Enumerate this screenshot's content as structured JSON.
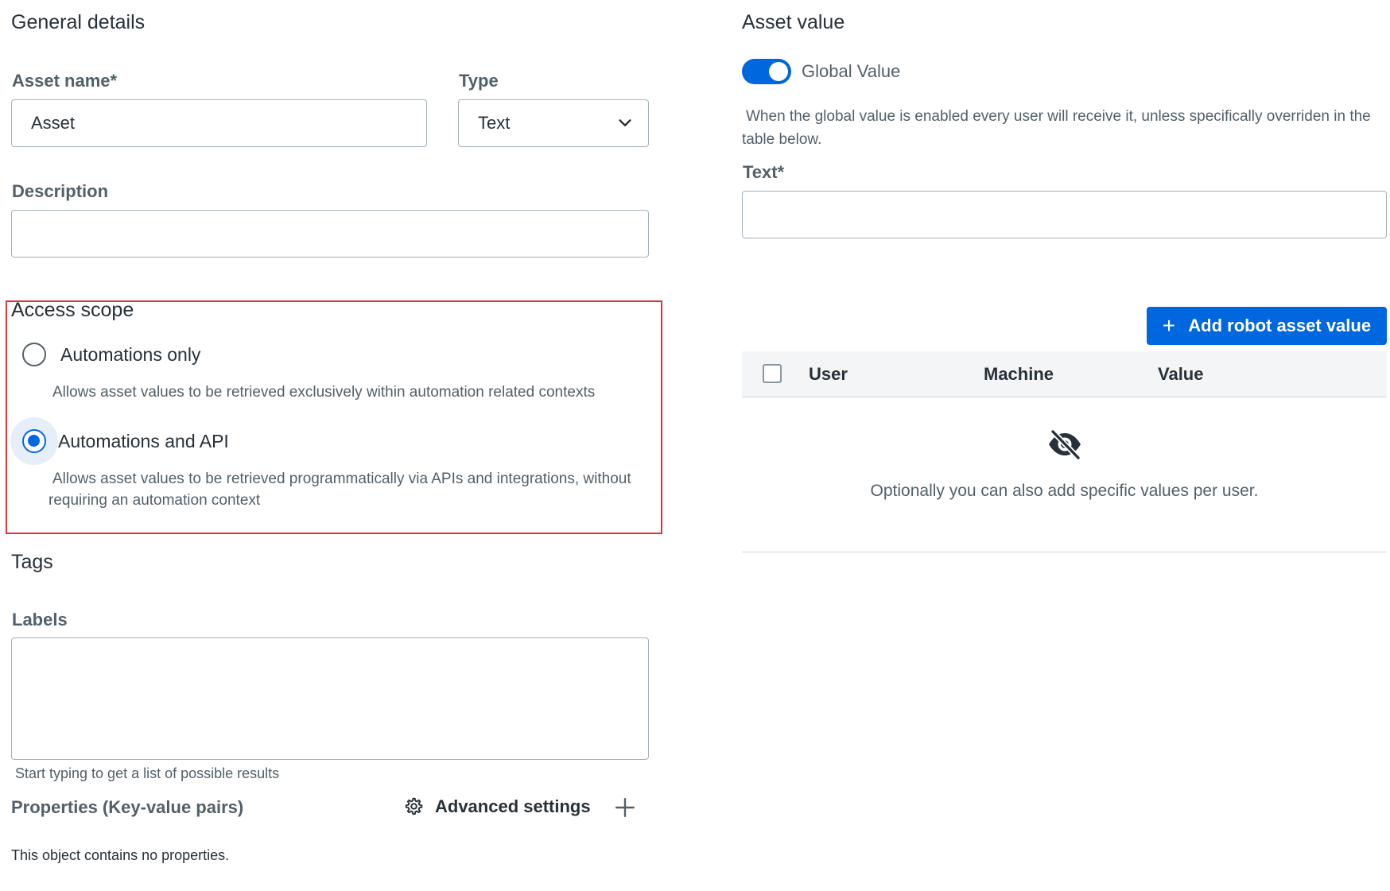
{
  "general": {
    "title": "General details",
    "asset_name_label": "Asset name",
    "required_mark": "*",
    "asset_name_value": "Asset",
    "type_label": "Type",
    "type_value": "Text",
    "description_label": "Description",
    "description_value": ""
  },
  "access_scope": {
    "title": "Access scope",
    "options": [
      {
        "label": "Automations only",
        "help": "Allows asset values to be retrieved exclusively within automation related contexts",
        "checked": false
      },
      {
        "label": "Automations and API",
        "help_line1": "Allows asset values to be retrieved programmatically via APIs and integrations, without",
        "help_line2": "requiring an automation context",
        "checked": true
      }
    ],
    "highlight_color": "#e0343c"
  },
  "tags": {
    "title": "Tags",
    "labels_label": "Labels",
    "labels_value": "",
    "labels_hint": "Start typing to get a list of possible results"
  },
  "properties": {
    "title": "Properties (Key-value pairs)",
    "advanced_settings": "Advanced settings",
    "advanced_icon": "gear-icon",
    "add_icon": "plus-icon",
    "empty_text": "This object contains no properties."
  },
  "asset_value": {
    "title": "Asset value",
    "global_value_label": "Global Value",
    "global_value_enabled": true,
    "global_help_line1": "When the global value is enabled every user will receive it, unless specifically overriden in the",
    "global_help_line2": "table below.",
    "text_label": "Text",
    "text_value": "",
    "add_button": "Add robot asset value",
    "table": {
      "columns": [
        "User",
        "Machine",
        "Value"
      ],
      "empty_icon": "eye-off-icon",
      "empty_text": "Optionally you can also add specific values per user."
    }
  },
  "colors": {
    "primary": "#0067df",
    "text": "#273139",
    "secondary_text": "#526069",
    "border": "#a4b1b8"
  }
}
